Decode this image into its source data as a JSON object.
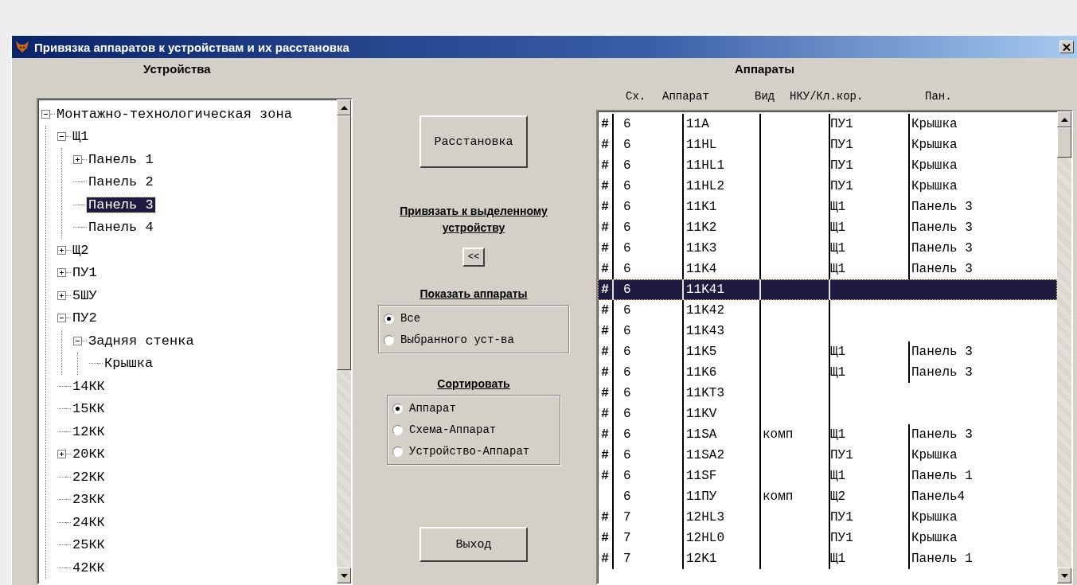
{
  "window": {
    "title": "Привязка аппаратов к устройствам и их расстановка"
  },
  "devices": {
    "heading": "Устройства",
    "tree": [
      {
        "label": "Монтажно-технологическая зона",
        "selected": false,
        "expanded": true,
        "children": [
          {
            "label": "Щ1",
            "selected": false,
            "expanded": true,
            "children": [
              {
                "label": "Панель 1",
                "selected": false,
                "expanded": false
              },
              {
                "label": "Панель 2",
                "selected": false
              },
              {
                "label": "Панель 3",
                "selected": true
              },
              {
                "label": "Панель 4",
                "selected": false
              }
            ]
          },
          {
            "label": "Щ2",
            "selected": false,
            "expanded": false
          },
          {
            "label": "ПУ1",
            "selected": false,
            "expanded": false
          },
          {
            "label": "5ШУ",
            "selected": false,
            "expanded": false
          },
          {
            "label": "ПУ2",
            "selected": false,
            "expanded": true,
            "children": [
              {
                "label": "Задняя стенка",
                "selected": false,
                "expanded": true,
                "children": [
                  {
                    "label": "Крышка",
                    "selected": false
                  }
                ]
              }
            ]
          },
          {
            "label": "14КК",
            "selected": false
          },
          {
            "label": "15КК",
            "selected": false
          },
          {
            "label": "12КК",
            "selected": false
          },
          {
            "label": "20КК",
            "selected": false,
            "expanded": false
          },
          {
            "label": "22КК",
            "selected": false
          },
          {
            "label": "23КК",
            "selected": false
          },
          {
            "label": "24КК",
            "selected": false
          },
          {
            "label": "25КК",
            "selected": false
          },
          {
            "label": "42КК",
            "selected": false
          }
        ]
      }
    ]
  },
  "actions": {
    "place_button": "Расстановка",
    "bind_label": "Привязать к выделенному устройству",
    "bind_button": "<<",
    "show": {
      "heading": "Показать аппараты",
      "options": [
        {
          "label": "Все",
          "selected": true
        },
        {
          "label": "Выбранного уст-ва",
          "selected": false
        }
      ]
    },
    "sort": {
      "heading": "Сортировать",
      "options": [
        {
          "label": "Аппарат",
          "selected": true
        },
        {
          "label": "Схема-Аппарат",
          "selected": false
        },
        {
          "label": "Устройство-Аппарат",
          "selected": false
        }
      ]
    },
    "exit_button": "Выход"
  },
  "apparatus": {
    "heading": "Аппараты",
    "columns": [
      "Сх.",
      "Аппарат",
      "Вид",
      "НКУ/Кл.кор.",
      "Пан."
    ],
    "rows": [
      {
        "mark": "#",
        "cells": [
          "6",
          "11A",
          "",
          "ПУ1",
          "Крышка"
        ],
        "selected": false
      },
      {
        "mark": "#",
        "cells": [
          "6",
          "11HL",
          "",
          "ПУ1",
          "Крышка"
        ],
        "selected": false
      },
      {
        "mark": "#",
        "cells": [
          "6",
          "11HL1",
          "",
          "ПУ1",
          "Крышка"
        ],
        "selected": false
      },
      {
        "mark": "#",
        "cells": [
          "6",
          "11HL2",
          "",
          "ПУ1",
          "Крышка"
        ],
        "selected": false
      },
      {
        "mark": "#",
        "cells": [
          "6",
          "11K1",
          "",
          "Щ1",
          "Панель 3"
        ],
        "selected": false
      },
      {
        "mark": "#",
        "cells": [
          "6",
          "11K2",
          "",
          "Щ1",
          "Панель 3"
        ],
        "selected": false
      },
      {
        "mark": "#",
        "cells": [
          "6",
          "11K3",
          "",
          "Щ1",
          "Панель 3"
        ],
        "selected": false
      },
      {
        "mark": "#",
        "cells": [
          "6",
          "11K4",
          "",
          "Щ1",
          "Панель 3"
        ],
        "selected": false
      },
      {
        "mark": "#",
        "cells": [
          "6",
          "11K41",
          "",
          "",
          ""
        ],
        "selected": true
      },
      {
        "mark": "#",
        "cells": [
          "6",
          "11K42",
          "",
          "",
          ""
        ],
        "selected": false
      },
      {
        "mark": "#",
        "cells": [
          "6",
          "11K43",
          "",
          "",
          ""
        ],
        "selected": false
      },
      {
        "mark": "#",
        "cells": [
          "6",
          "11K5",
          "",
          "Щ1",
          "Панель 3"
        ],
        "selected": false
      },
      {
        "mark": "#",
        "cells": [
          "6",
          "11K6",
          "",
          "Щ1",
          "Панель 3"
        ],
        "selected": false
      },
      {
        "mark": "#",
        "cells": [
          "6",
          "11KT3",
          "",
          "",
          ""
        ],
        "selected": false
      },
      {
        "mark": "#",
        "cells": [
          "6",
          "11KV",
          "",
          "",
          ""
        ],
        "selected": false
      },
      {
        "mark": "#",
        "cells": [
          "6",
          "11SA",
          "комп",
          "Щ1",
          "Панель 3"
        ],
        "selected": false
      },
      {
        "mark": "#",
        "cells": [
          "6",
          "11SA2",
          "",
          "ПУ1",
          "Крышка"
        ],
        "selected": false
      },
      {
        "mark": "#",
        "cells": [
          "6",
          "11SF",
          "",
          "Щ1",
          "Панель 1"
        ],
        "selected": false
      },
      {
        "cells": [
          "6",
          "11ПУ",
          "комп",
          "Щ2",
          "Панель4"
        ],
        "selected": false
      },
      {
        "mark": "#",
        "cells": [
          "7",
          "12HL3",
          "",
          "ПУ1",
          "Крышка"
        ],
        "selected": false
      },
      {
        "mark": "#",
        "cells": [
          "7",
          "12HL0",
          "",
          "ПУ1",
          "Крышка"
        ],
        "selected": false
      },
      {
        "mark": "#",
        "cells": [
          "7",
          "12K1",
          "",
          "Щ1",
          "Панель 1"
        ],
        "selected": false
      }
    ]
  }
}
